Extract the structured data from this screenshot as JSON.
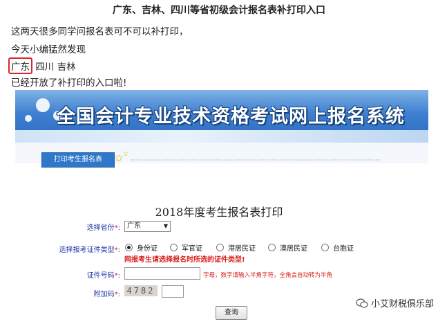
{
  "article": {
    "title": "广东、吉林、四川等省初级会计报名表补打印入口",
    "line1": "这两天很多同学问报名表可不可以补打印，",
    "line2": "今天小编猛然发现",
    "line3_highlight": "广东",
    "line3_rest": " 四川 吉林",
    "line4": "已经开放了补打印的入口啦!"
  },
  "site": {
    "banner_title": "全国会计专业技术资格考试网上报名系统",
    "tab_label": "打印考生报名表"
  },
  "form": {
    "title": "2018年度考生报名表打印",
    "province_label": "选择省份",
    "province_value": "广东",
    "idtype_label": "选择报考证件类型",
    "idtypes": [
      "身份证",
      "军官证",
      "港居民证",
      "澳居民证",
      "台胞证"
    ],
    "selected_idtype": "身份证",
    "warning": "网报考生请选择报名时所选的证件类型!",
    "idnum_label": "证件号码",
    "idnum_hint": "字母，数字请输入半角字符，全角会自动转为半角",
    "captcha_label": "附加码",
    "captcha_value": "4782",
    "required_mark": "*",
    "submit_label": "查询"
  },
  "watermark": {
    "text": "小艾财税俱乐部"
  },
  "colors": {
    "highlight_border": "#d8262a",
    "warning_text": "#d81e1e",
    "label_text": "#2233aa",
    "banner_blue": "#2d6cc0"
  }
}
